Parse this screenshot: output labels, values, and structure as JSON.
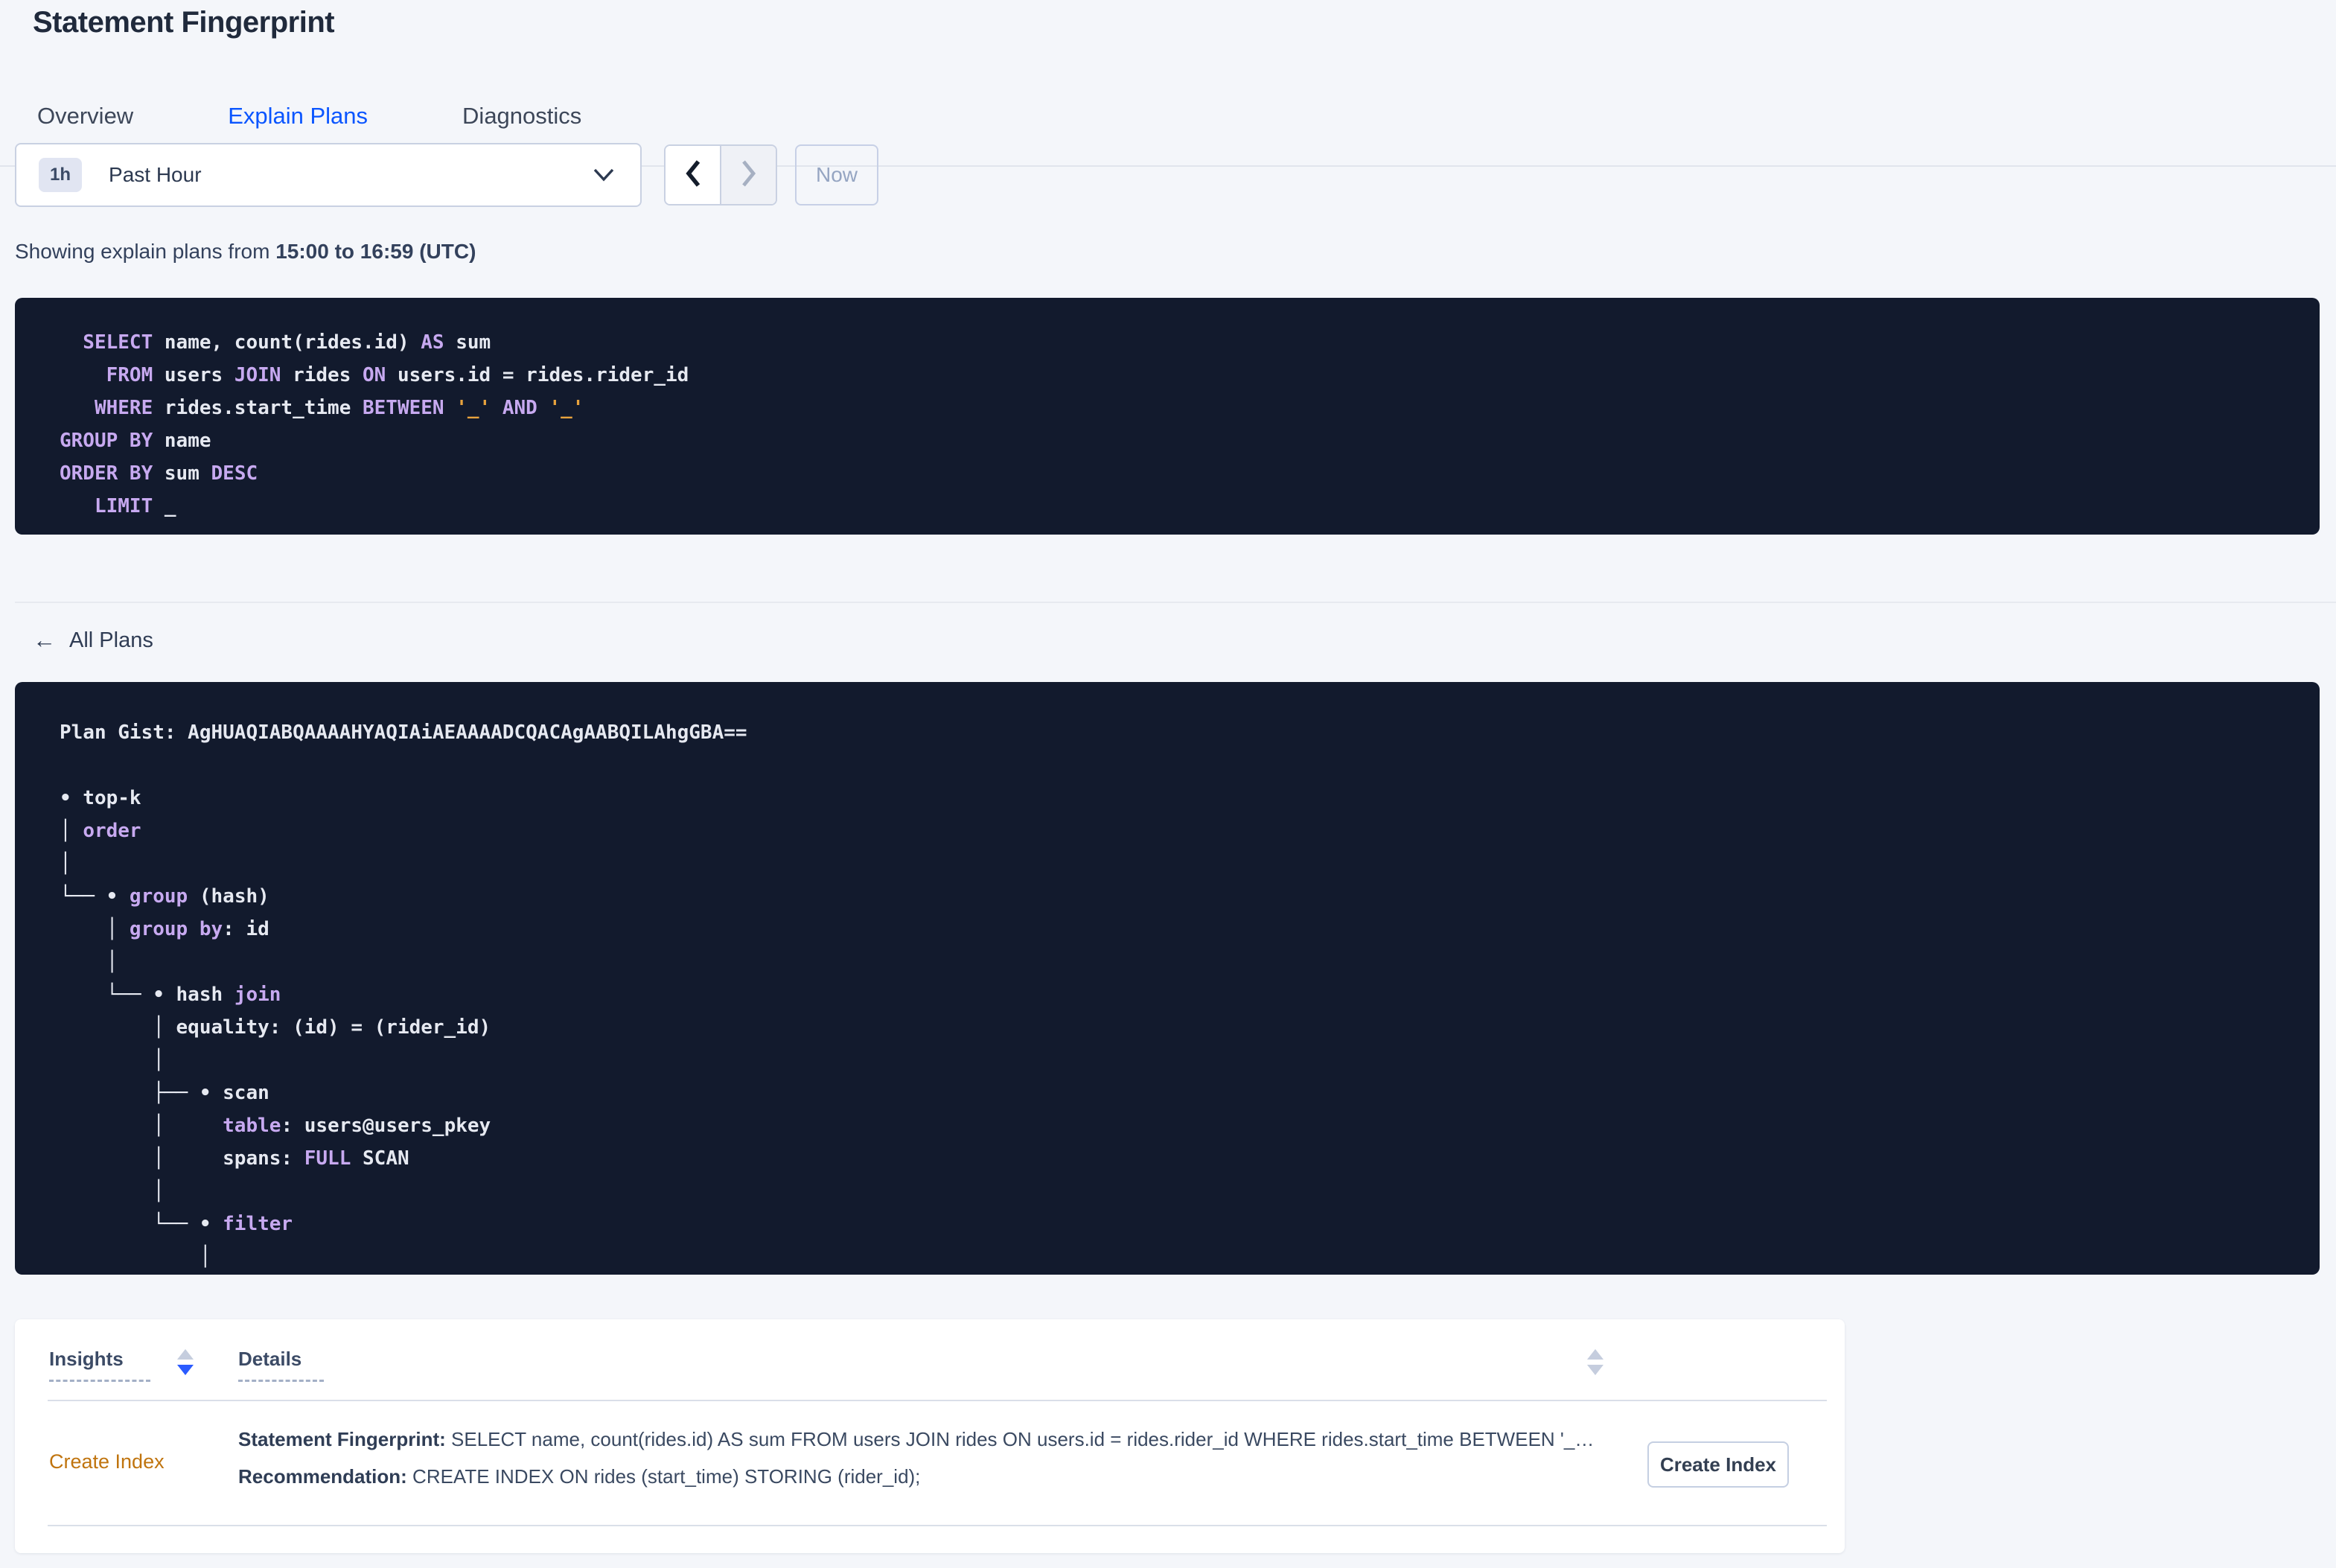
{
  "header": {
    "title": "Statement Fingerprint"
  },
  "tabs": {
    "overview": "Overview",
    "explain_plans": "Explain Plans",
    "diagnostics": "Diagnostics",
    "active_tab": "Explain Plans"
  },
  "time_picker": {
    "interval_badge": "1h",
    "selected_range": "Past Hour",
    "now_label": "Now"
  },
  "status_line": {
    "prefix": "Showing explain plans from",
    "range_bold": "15:00 to 16:59 (UTC)"
  },
  "sql_block": {
    "lines": [
      [
        {
          "c": "k",
          "t": "  SELECT"
        },
        {
          "c": "t",
          "t": " name, count(rides.id) "
        },
        {
          "c": "k",
          "t": "AS"
        },
        {
          "c": "t",
          "t": " sum"
        }
      ],
      [
        {
          "c": "k",
          "t": "    FROM"
        },
        {
          "c": "t",
          "t": " users "
        },
        {
          "c": "k",
          "t": "JOIN"
        },
        {
          "c": "t",
          "t": " rides "
        },
        {
          "c": "k",
          "t": "ON"
        },
        {
          "c": "t",
          "t": " users.id = rides.rider_id"
        }
      ],
      [
        {
          "c": "k",
          "t": "   WHERE"
        },
        {
          "c": "t",
          "t": " rides.start_time "
        },
        {
          "c": "k",
          "t": "BETWEEN"
        },
        {
          "c": "t",
          "t": " "
        },
        {
          "c": "s",
          "t": "'_'"
        },
        {
          "c": "t",
          "t": " "
        },
        {
          "c": "k",
          "t": "AND"
        },
        {
          "c": "t",
          "t": " "
        },
        {
          "c": "s",
          "t": "'_'"
        }
      ],
      [
        {
          "c": "k",
          "t": "GROUP BY"
        },
        {
          "c": "t",
          "t": " name"
        }
      ],
      [
        {
          "c": "k",
          "t": "ORDER BY"
        },
        {
          "c": "t",
          "t": " sum "
        },
        {
          "c": "k",
          "t": "DESC"
        }
      ],
      [
        {
          "c": "k",
          "t": "   LIMIT"
        },
        {
          "c": "t",
          "t": " _"
        }
      ]
    ]
  },
  "plans_nav": {
    "back_label": "All Plans"
  },
  "plan_block": {
    "lines": [
      [
        {
          "c": "t",
          "t": "Plan Gist: AgHUAQIABQAAAAHYAQIAiAEAAAADCQACAgAABQILAhgGBA=="
        }
      ],
      [],
      [
        {
          "c": "t",
          "t": "• top-k"
        }
      ],
      [
        {
          "c": "t",
          "t": "│ "
        },
        {
          "c": "k",
          "t": "order"
        }
      ],
      [
        {
          "c": "t",
          "t": "│"
        }
      ],
      [
        {
          "c": "t",
          "t": "└── • "
        },
        {
          "c": "k",
          "t": "group"
        },
        {
          "c": "t",
          "t": " (hash)"
        }
      ],
      [
        {
          "c": "t",
          "t": "    │ "
        },
        {
          "c": "k",
          "t": "group by"
        },
        {
          "c": "t",
          "t": ": id"
        }
      ],
      [
        {
          "c": "t",
          "t": "    │"
        }
      ],
      [
        {
          "c": "t",
          "t": "    └── • hash "
        },
        {
          "c": "k",
          "t": "join"
        }
      ],
      [
        {
          "c": "t",
          "t": "        │ equality: (id) = (rider_id)"
        }
      ],
      [
        {
          "c": "t",
          "t": "        │"
        }
      ],
      [
        {
          "c": "t",
          "t": "        ├── • scan"
        }
      ],
      [
        {
          "c": "t",
          "t": "        │     "
        },
        {
          "c": "k",
          "t": "table"
        },
        {
          "c": "t",
          "t": ": users@users_pkey"
        }
      ],
      [
        {
          "c": "t",
          "t": "        │     spans: "
        },
        {
          "c": "k",
          "t": "FULL"
        },
        {
          "c": "t",
          "t": " SCAN"
        }
      ],
      [
        {
          "c": "t",
          "t": "        │"
        }
      ],
      [
        {
          "c": "t",
          "t": "        └── • "
        },
        {
          "c": "k",
          "t": "filter"
        }
      ],
      [
        {
          "c": "t",
          "t": "            │"
        }
      ]
    ]
  },
  "insights_table": {
    "col_insights": "Insights",
    "col_details": "Details",
    "insights_sort": "desc",
    "details_sort": "none",
    "row": {
      "insight_link": "Create Index",
      "fingerprint_label": "Statement Fingerprint:",
      "fingerprint_text": " SELECT name, count(rides.id) AS sum FROM users JOIN rides ON users.id = rides.rider_id WHERE rides.start_time BETWEEN '_…",
      "recommendation_label": "Recommendation:",
      "recommendation_text": " CREATE INDEX ON rides (start_time) STORING (rider_id);",
      "action_button": "Create Index"
    }
  },
  "colors": {
    "accent_blue": "#0a55ff",
    "code_bg": "#121a2d",
    "code_keyword": "#c7a9f0",
    "code_string": "#e8a33d",
    "code_text": "#e6e9f1",
    "insight_link_orange": "#c0740e",
    "sort_active_blue": "#2b5bff"
  }
}
